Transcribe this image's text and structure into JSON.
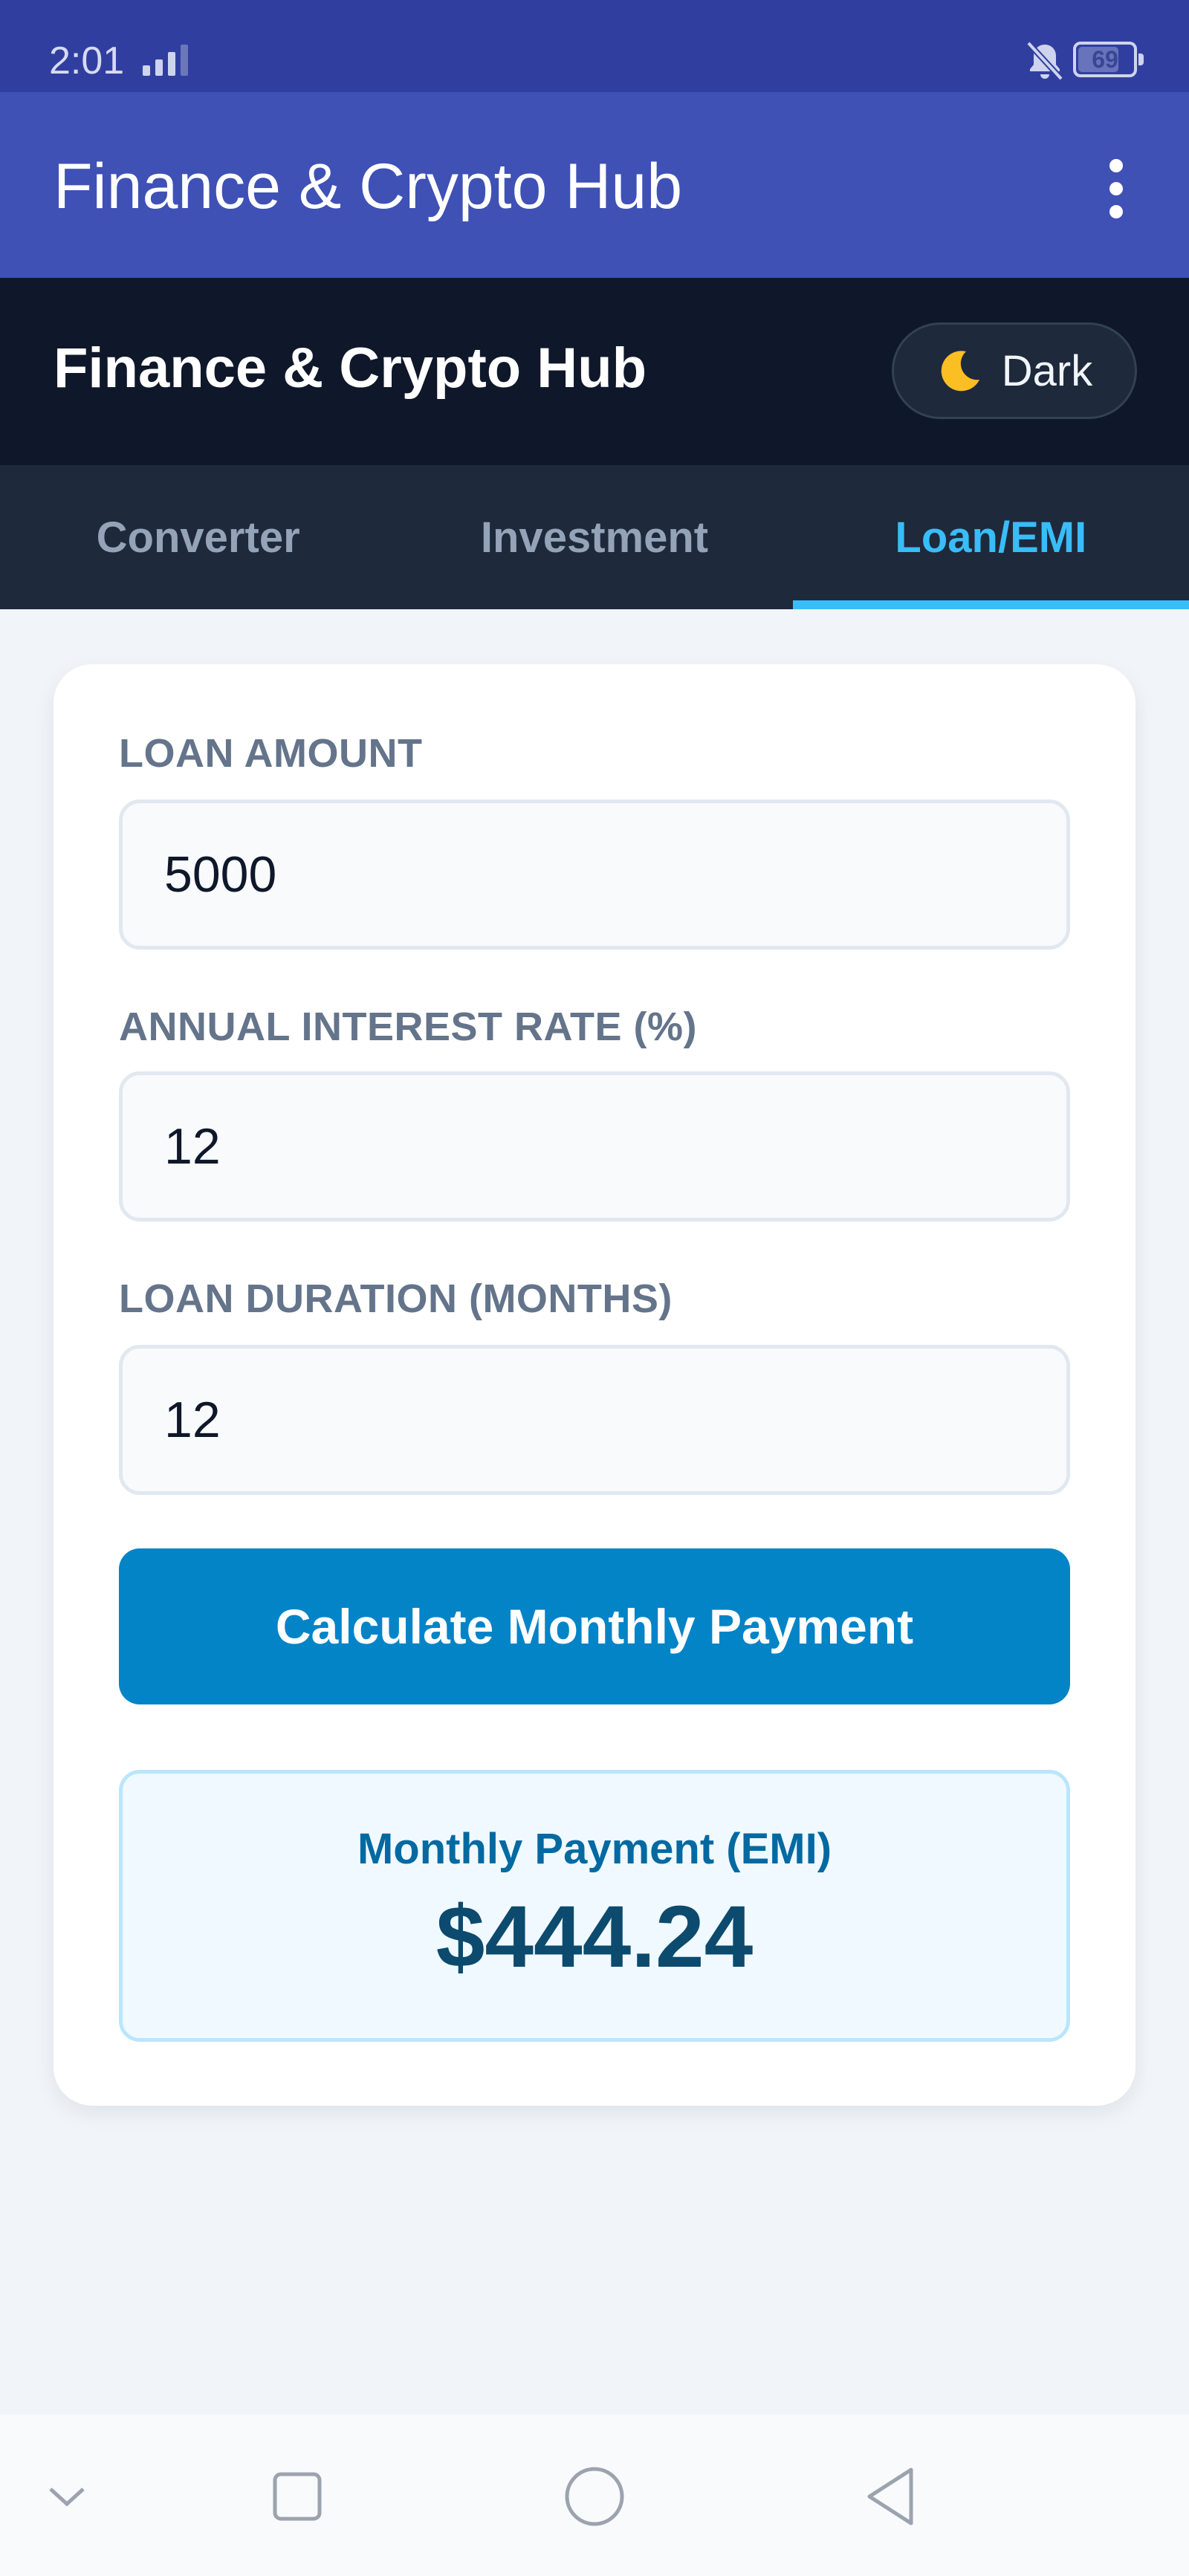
{
  "status": {
    "time": "2:01",
    "battery": "69",
    "battery_level": 0.69
  },
  "appbar": {
    "title": "Finance & Crypto Hub"
  },
  "header": {
    "title": "Finance & Crypto Hub",
    "theme_label": "Dark"
  },
  "tabs": [
    {
      "label": "Converter"
    },
    {
      "label": "Investment"
    },
    {
      "label": "Loan/EMI"
    }
  ],
  "form": {
    "loan_amount": {
      "label": "LOAN AMOUNT",
      "value": "5000"
    },
    "interest_rate": {
      "label": "ANNUAL INTEREST RATE (%)",
      "value": "12"
    },
    "duration": {
      "label": "LOAN DURATION (MONTHS)",
      "value": "12"
    },
    "calculate_label": "Calculate Monthly Payment"
  },
  "result": {
    "label": "Monthly Payment (EMI)",
    "value": "$444.24"
  },
  "colors": {
    "appbar": "#3f51b5",
    "header": "#0f172a",
    "accent": "#38bdf8",
    "button": "#0284c7"
  }
}
